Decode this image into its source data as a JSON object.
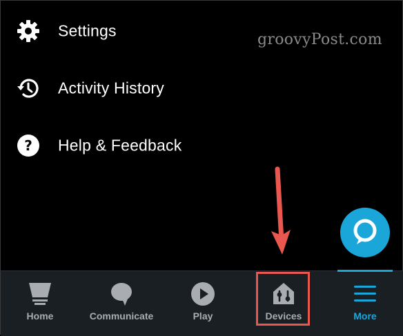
{
  "menu": {
    "items": [
      {
        "label": "Settings",
        "icon": "gear-icon"
      },
      {
        "label": "Activity History",
        "icon": "history-icon"
      },
      {
        "label": "Help & Feedback",
        "icon": "help-icon"
      }
    ]
  },
  "watermark": "groovyPost.com",
  "bottom_nav": {
    "items": [
      {
        "label": "Home",
        "icon": "home-icon"
      },
      {
        "label": "Communicate",
        "icon": "chat-bubble-icon"
      },
      {
        "label": "Play",
        "icon": "play-icon"
      },
      {
        "label": "Devices",
        "icon": "devices-house-icon"
      },
      {
        "label": "More",
        "icon": "menu-lines-icon",
        "active": true
      }
    ]
  },
  "colors": {
    "background": "#000000",
    "nav_background": "#1a1f24",
    "accent": "#1aa6d9",
    "nav_inactive": "#a9adb1",
    "annotation": "#e9574f"
  }
}
